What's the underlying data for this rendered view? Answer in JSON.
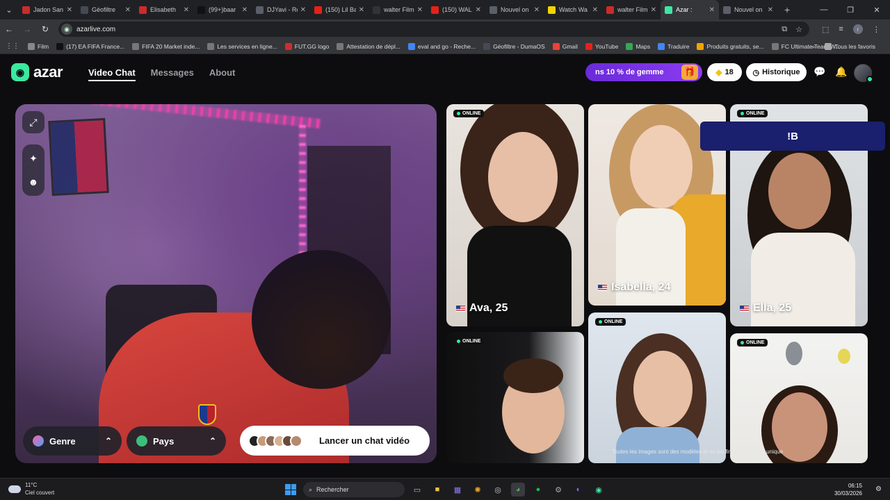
{
  "browser": {
    "tabs": [
      {
        "title": "Jadon San",
        "color": "#cc2b2b"
      },
      {
        "title": "Géofiltre",
        "color": "#444a55"
      },
      {
        "title": "Elisabeth",
        "color": "#cc2b2b"
      },
      {
        "title": "(99+)baar",
        "color": "#111111"
      },
      {
        "title": "DJYavi - Re",
        "color": "#5a5f6a"
      },
      {
        "title": "(150) Lil Ba",
        "color": "#e62117"
      },
      {
        "title": "walter Film",
        "color": "#333333"
      },
      {
        "title": "(150) WAL",
        "color": "#e62117"
      },
      {
        "title": "Nouvel on",
        "color": "#5a5f6a"
      },
      {
        "title": "Watch Wa",
        "color": "#f2d400"
      },
      {
        "title": "walter Film",
        "color": "#cc2b2b"
      },
      {
        "title": "Azar :",
        "color": "#3be8a0"
      },
      {
        "title": "Nouvel on",
        "color": "#5a5f6a"
      }
    ],
    "url": "azarlive.com",
    "bookmarks": [
      {
        "label": "Film",
        "color": "#888888"
      },
      {
        "label": "(17) EA FIFA France...",
        "color": "#111111"
      },
      {
        "label": "FIFA 20 Market inde...",
        "color": "#777777"
      },
      {
        "label": "Les services en ligne...",
        "color": "#777777"
      },
      {
        "label": "FUT.GG logo",
        "color": "#d02d2d"
      },
      {
        "label": "Attestation de dépl...",
        "color": "#777777"
      },
      {
        "label": "eval and go - Reche...",
        "color": "#4285f4"
      },
      {
        "label": "Géofiltre - DumaOS",
        "color": "#444a55"
      },
      {
        "label": "Gmail",
        "color": "#ea4335"
      },
      {
        "label": "YouTube",
        "color": "#e62117"
      },
      {
        "label": "Maps",
        "color": "#34a853"
      },
      {
        "label": "Traduire",
        "color": "#4285f4"
      },
      {
        "label": "Produits gratuits, se...",
        "color": "#f1a400"
      },
      {
        "label": "FC Ultimate Team W...",
        "color": "#777777"
      }
    ],
    "all_favorites": "Tous les favoris"
  },
  "site": {
    "logo": "azar",
    "nav": [
      "Video Chat",
      "Messages",
      "About"
    ],
    "promo": "ns 10 % de gemme",
    "gems": "18",
    "history": "Historique"
  },
  "camera": {
    "gender_filter": "Genre",
    "country_filter": "Pays",
    "launch": "Lancer un chat vidéo"
  },
  "profiles": {
    "online": "ONLINE",
    "cards": [
      {
        "label": "Ava, 25"
      },
      {
        "label": "Isabella, 24"
      },
      {
        "label": "Ella, 25"
      }
    ]
  },
  "overlay_text": "!B",
  "disclaimer": "Toutes les images sont des modèles et so                    les fins d'illustration unique",
  "taskbar": {
    "temp": "11°C",
    "weather": "Ciel couvert",
    "search": "Rechercher",
    "time": "06:15",
    "date": "30/03/2026"
  }
}
